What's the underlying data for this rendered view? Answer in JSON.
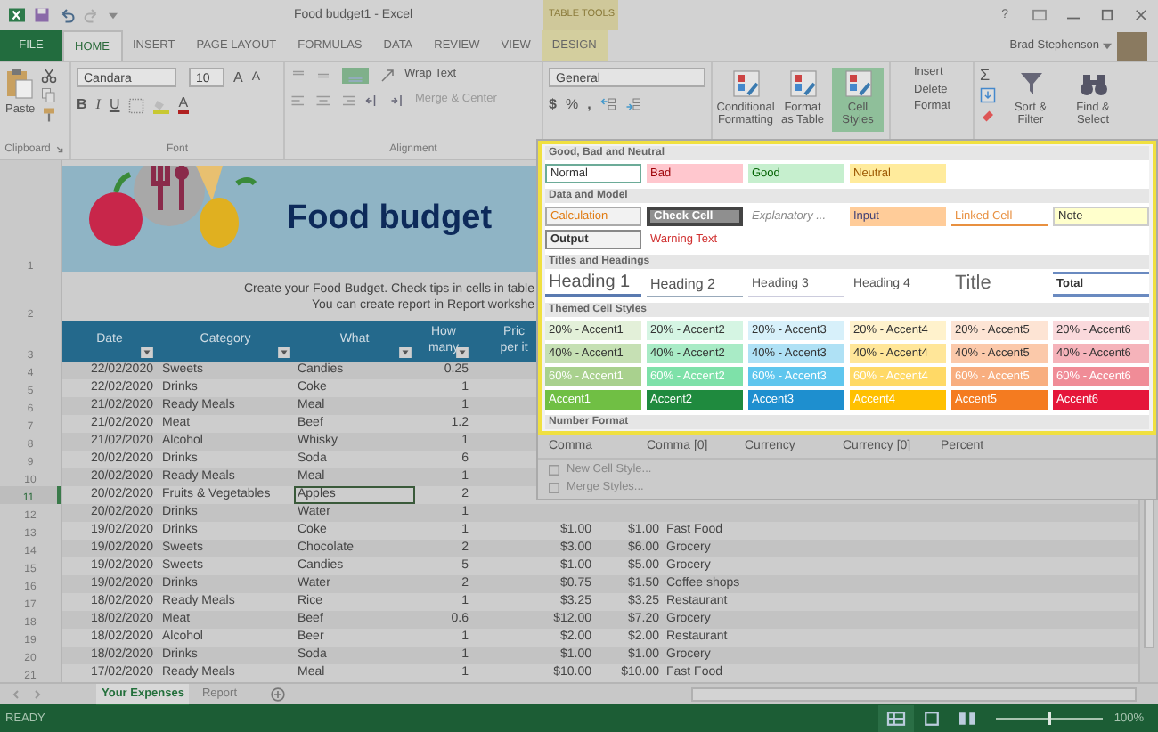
{
  "title_bar": {
    "title": "Food budget1 - Excel",
    "context_group": "TABLE TOOLS",
    "help": "?"
  },
  "tabs": [
    {
      "label": "FILE",
      "kind": "file",
      "selected": false
    },
    {
      "label": "HOME",
      "kind": "tab",
      "selected": true
    },
    {
      "label": "INSERT",
      "kind": "tab",
      "selected": false
    },
    {
      "label": "PAGE LAYOUT",
      "kind": "tab",
      "selected": false
    },
    {
      "label": "FORMULAS",
      "kind": "tab",
      "selected": false
    },
    {
      "label": "DATA",
      "kind": "tab",
      "selected": false
    },
    {
      "label": "REVIEW",
      "kind": "tab",
      "selected": false
    },
    {
      "label": "VIEW",
      "kind": "tab",
      "selected": false
    },
    {
      "label": "DESIGN",
      "kind": "context",
      "selected": false
    }
  ],
  "user": {
    "name": "Brad Stephenson"
  },
  "ribbon": {
    "clipboard": {
      "label": "Clipboard",
      "paste": "Paste"
    },
    "font": {
      "label": "Font",
      "family": "Candara",
      "size": "10",
      "grow": "A",
      "shrink": "A",
      "bold": "B",
      "italic": "I",
      "underline": "U",
      "font_color_letter": "A"
    },
    "alignment": {
      "label": "Alignment",
      "wrap": "Wrap Text",
      "merge": "Merge & Center"
    },
    "number": {
      "format": "General",
      "currency": "$",
      "percent": "%",
      "comma": ","
    },
    "styles": [
      {
        "label": "Conditional Formatting",
        "selected": false
      },
      {
        "label": "Format as Table",
        "selected": false
      },
      {
        "label": "Cell Styles",
        "selected": true
      }
    ],
    "cells": [
      "Insert",
      "Delete",
      "Format"
    ],
    "editing": {
      "sum": "Σ",
      "buttons": [
        "Sort & Filter",
        "Find & Select"
      ]
    }
  },
  "sheet": {
    "row_headers": [
      "1",
      "2",
      "3"
    ],
    "banner_title": "Food budget",
    "intro": [
      "Create your Food Budget. Check tips in cells in table",
      "You can create report in Report workshe"
    ],
    "columns": [
      "Date",
      "Category",
      "What",
      "How many",
      "Pric per it"
    ],
    "rows": [
      {
        "row": "4",
        "date": "22/02/2020",
        "category": "Sweets",
        "what": "Candies",
        "how_many": "0.25",
        "selected": false
      },
      {
        "row": "5",
        "date": "22/02/2020",
        "category": "Drinks",
        "what": "Coke",
        "how_many": "1",
        "selected": false
      },
      {
        "row": "6",
        "date": "21/02/2020",
        "category": "Ready Meals",
        "what": "Meal",
        "how_many": "1",
        "selected": false
      },
      {
        "row": "7",
        "date": "21/02/2020",
        "category": "Meat",
        "what": "Beef",
        "how_many": "1.2",
        "selected": false
      },
      {
        "row": "8",
        "date": "21/02/2020",
        "category": "Alcohol",
        "what": "Whisky",
        "how_many": "1",
        "selected": false
      },
      {
        "row": "9",
        "date": "20/02/2020",
        "category": "Drinks",
        "what": "Soda",
        "how_many": "6",
        "selected": false
      },
      {
        "row": "10",
        "date": "20/02/2020",
        "category": "Ready Meals",
        "what": "Meal",
        "how_many": "1",
        "selected": false
      },
      {
        "row": "11",
        "date": "20/02/2020",
        "category": "Fruits & Vegetables",
        "what": "Apples",
        "how_many": "2",
        "selected": true
      },
      {
        "row": "12",
        "date": "20/02/2020",
        "category": "Drinks",
        "what": "Water",
        "how_many": "1",
        "selected": false
      },
      {
        "row": "13",
        "date": "19/02/2020",
        "category": "Drinks",
        "what": "Coke",
        "how_many": "1",
        "price": "$1.00",
        "total": "$1.00",
        "type": "Fast Food",
        "selected": false
      },
      {
        "row": "14",
        "date": "19/02/2020",
        "category": "Sweets",
        "what": "Chocolate",
        "how_many": "2",
        "price": "$3.00",
        "total": "$6.00",
        "type": "Grocery",
        "selected": false
      },
      {
        "row": "15",
        "date": "19/02/2020",
        "category": "Sweets",
        "what": "Candies",
        "how_many": "5",
        "price": "$1.00",
        "total": "$5.00",
        "type": "Grocery",
        "selected": false
      },
      {
        "row": "16",
        "date": "19/02/2020",
        "category": "Drinks",
        "what": "Water",
        "how_many": "2",
        "price": "$0.75",
        "total": "$1.50",
        "type": "Coffee shops",
        "selected": false
      },
      {
        "row": "17",
        "date": "18/02/2020",
        "category": "Ready Meals",
        "what": "Rice",
        "how_many": "1",
        "price": "$3.25",
        "total": "$3.25",
        "type": "Restaurant",
        "selected": false
      },
      {
        "row": "18",
        "date": "18/02/2020",
        "category": "Meat",
        "what": "Beef",
        "how_many": "0.6",
        "price": "$12.00",
        "total": "$7.20",
        "type": "Grocery",
        "selected": false
      },
      {
        "row": "19",
        "date": "18/02/2020",
        "category": "Alcohol",
        "what": "Beer",
        "how_many": "1",
        "price": "$2.00",
        "total": "$2.00",
        "type": "Restaurant",
        "selected": false
      },
      {
        "row": "20",
        "date": "18/02/2020",
        "category": "Drinks",
        "what": "Soda",
        "how_many": "1",
        "price": "$1.00",
        "total": "$1.00",
        "type": "Grocery",
        "selected": false
      },
      {
        "row": "21",
        "date": "17/02/2020",
        "category": "Ready Meals",
        "what": "Meal",
        "how_many": "1",
        "price": "$10.00",
        "total": "$10.00",
        "type": "Fast Food",
        "selected": false
      }
    ]
  },
  "cell_styles": {
    "sections": [
      {
        "title": "Good, Bad and Neutral",
        "items": [
          {
            "label": "Normal",
            "kind": "normal"
          },
          {
            "label": "Bad",
            "kind": "bad"
          },
          {
            "label": "Good",
            "kind": "good"
          },
          {
            "label": "Neutral",
            "kind": "neutral"
          }
        ]
      },
      {
        "title": "Data and Model",
        "items": [
          {
            "label": "Calculation",
            "kind": "calculation"
          },
          {
            "label": "Check Cell",
            "kind": "check"
          },
          {
            "label": "Explanatory ...",
            "kind": "explanatory"
          },
          {
            "label": "Input",
            "kind": "input"
          },
          {
            "label": "Linked Cell",
            "kind": "linked"
          },
          {
            "label": "Note",
            "kind": "note"
          },
          {
            "label": "Output",
            "kind": "output"
          },
          {
            "label": "Warning Text",
            "kind": "warning"
          }
        ]
      },
      {
        "title": "Titles and Headings",
        "items": [
          {
            "label": "Heading 1",
            "kind": "heading1"
          },
          {
            "label": "Heading 2",
            "kind": "heading2"
          },
          {
            "label": "Heading 3",
            "kind": "heading3"
          },
          {
            "label": "Heading 4",
            "kind": "heading4"
          },
          {
            "label": "Title",
            "kind": "title"
          },
          {
            "label": "Total",
            "kind": "total"
          }
        ]
      },
      {
        "title": "Themed Cell Styles",
        "items": [
          {
            "label": "20% - Accent1",
            "kind": "accent_light",
            "color": "#e3f0d9"
          },
          {
            "label": "20% - Accent2",
            "kind": "accent_light",
            "color": "#d5f5e3"
          },
          {
            "label": "20% - Accent3",
            "kind": "accent_light",
            "color": "#d7f0fa"
          },
          {
            "label": "20% - Accent4",
            "kind": "accent_light",
            "color": "#fff2cc"
          },
          {
            "label": "20% - Accent5",
            "kind": "accent_light",
            "color": "#fde4d4"
          },
          {
            "label": "20% - Accent6",
            "kind": "accent_light",
            "color": "#fad9dc"
          },
          {
            "label": "40% - Accent1",
            "kind": "accent_light",
            "color": "#c6e0b4"
          },
          {
            "label": "40% - Accent2",
            "kind": "accent_light",
            "color": "#a9ebc6"
          },
          {
            "label": "40% - Accent3",
            "kind": "accent_light",
            "color": "#afe1f5"
          },
          {
            "label": "40% - Accent4",
            "kind": "accent_light",
            "color": "#ffe699"
          },
          {
            "label": "40% - Accent5",
            "kind": "accent_light",
            "color": "#fbc9aa"
          },
          {
            "label": "40% - Accent6",
            "kind": "accent_light",
            "color": "#f5b3ba"
          },
          {
            "label": "60% - Accent1",
            "kind": "accent_dark",
            "color": "#a9d18e"
          },
          {
            "label": "60% - Accent2",
            "kind": "accent_dark",
            "color": "#7ee1a9"
          },
          {
            "label": "60% - Accent3",
            "kind": "accent_dark",
            "color": "#5fc6ee"
          },
          {
            "label": "60% - Accent4",
            "kind": "accent_dark",
            "color": "#ffd966"
          },
          {
            "label": "60% - Accent5",
            "kind": "accent_dark",
            "color": "#f8ae7f"
          },
          {
            "label": "60% - Accent6",
            "kind": "accent_dark",
            "color": "#f08c97"
          },
          {
            "label": "Accent1",
            "kind": "accent_dark",
            "color": "#70bf44"
          },
          {
            "label": "Accent2",
            "kind": "accent_dark",
            "color": "#1f8a3e"
          },
          {
            "label": "Accent3",
            "kind": "accent_dark",
            "color": "#1e8fcf"
          },
          {
            "label": "Accent4",
            "kind": "accent_dark",
            "color": "#ffc000"
          },
          {
            "label": "Accent5",
            "kind": "accent_dark",
            "color": "#f47b20"
          },
          {
            "label": "Accent6",
            "kind": "accent_dark",
            "color": "#e5163a"
          }
        ]
      }
    ],
    "number_format": {
      "title": "Number Format",
      "items": [
        "Comma",
        "Comma [0]",
        "Currency",
        "Currency [0]",
        "Percent"
      ]
    },
    "actions": [
      "New Cell Style...",
      "Merge Styles..."
    ]
  },
  "sheet_tabs": [
    {
      "label": "Your Expenses",
      "selected": true
    },
    {
      "label": "Report",
      "selected": false
    }
  ],
  "status_bar": {
    "status": "READY",
    "zoom": {
      "level": 0.5,
      "reading": "100%"
    }
  }
}
